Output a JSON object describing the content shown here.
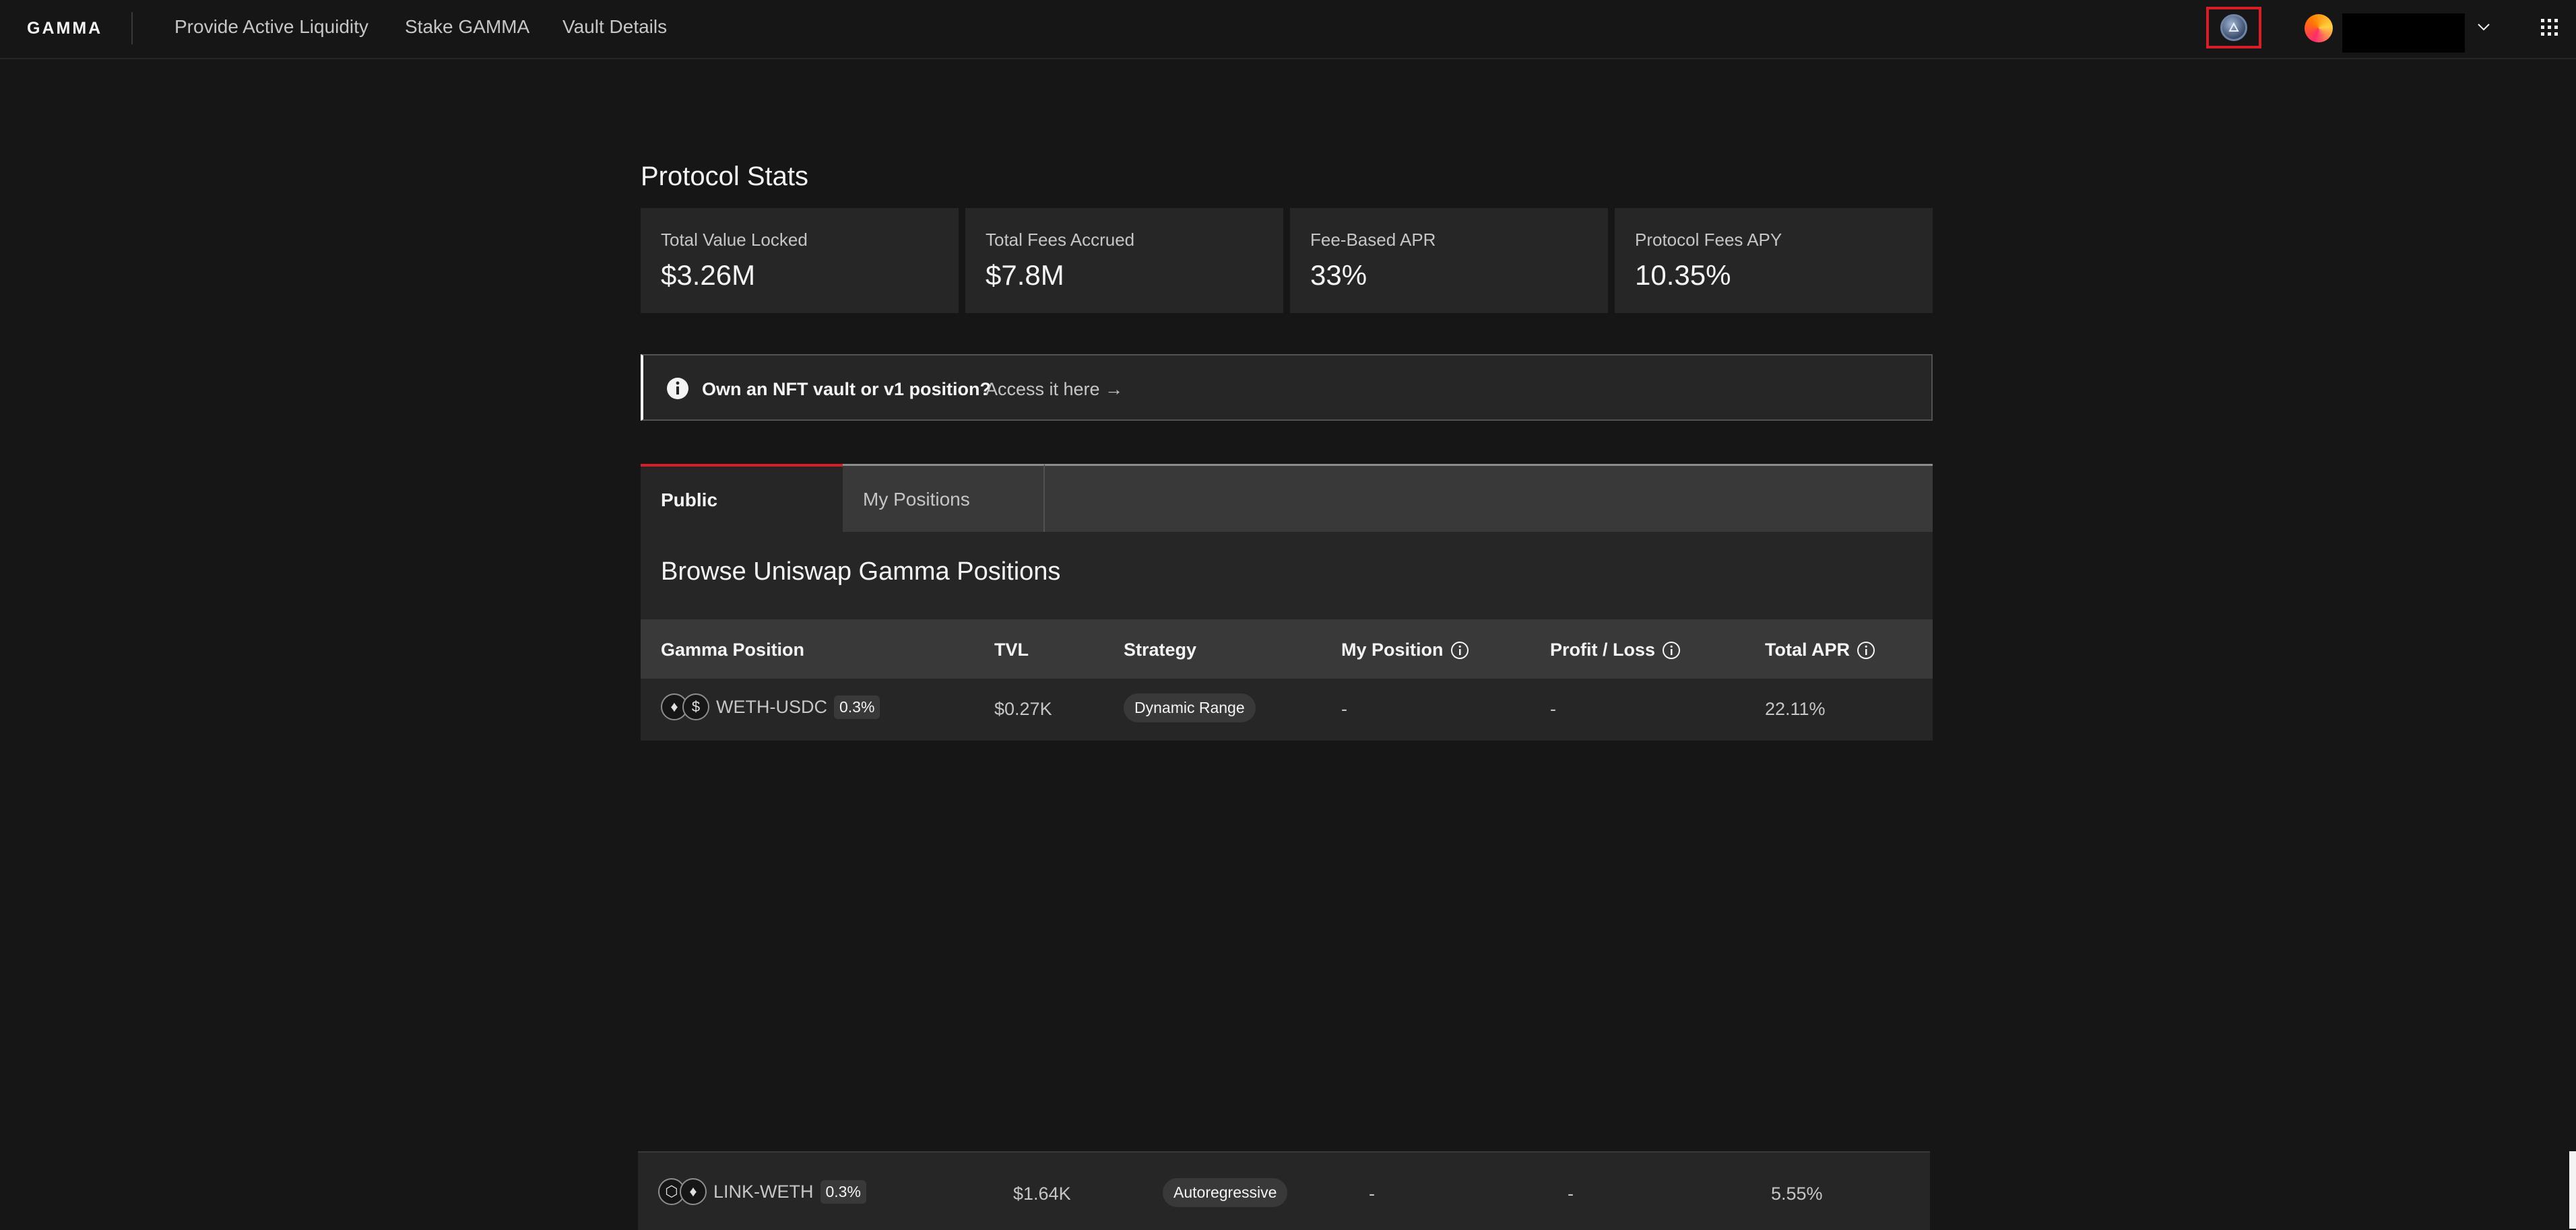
{
  "header": {
    "logo": "GAMMA",
    "nav": [
      "Provide Active Liquidity",
      "Stake GAMMA",
      "Vault Details"
    ]
  },
  "stats": {
    "title": "Protocol Stats",
    "cards": [
      {
        "label": "Total Value Locked",
        "value": "$3.26M"
      },
      {
        "label": "Total Fees Accrued",
        "value": "$7.8M"
      },
      {
        "label": "Fee-Based APR",
        "value": "33%"
      },
      {
        "label": "Protocol Fees APY",
        "value": "10.35%"
      }
    ]
  },
  "notice": {
    "title": "Own an NFT vault or v1 position?",
    "link": "Access it here →"
  },
  "tabs": [
    "Public",
    "My Positions"
  ],
  "browse": {
    "title": "Browse Uniswap Gamma Positions",
    "columns": [
      "Gamma Position",
      "TVL",
      "Strategy",
      "My Position",
      "Profit / Loss",
      "Total APR"
    ],
    "rows": [
      {
        "pair": "WETH-USDC",
        "fee": "0.3%",
        "tvl": "$0.27K",
        "strategy": "Dynamic Range",
        "my_position": "-",
        "pnl": "-",
        "apr": "22.11%"
      },
      {
        "pair": "LINK-WETH",
        "fee": "0.3%",
        "tvl": "$1.64K",
        "strategy": "Autoregressive",
        "my_position": "-",
        "pnl": "-",
        "apr": "5.55%"
      }
    ]
  },
  "colors": {
    "background": "#161616",
    "card": "#262626",
    "tab_accent": "#da1e28",
    "highlight_box": "#da1e28"
  },
  "icons": [
    "network-selector-icon",
    "wallet-avatar-icon",
    "chevron-down-icon",
    "app-switcher-icon",
    "info-icon",
    "eth-token-icon",
    "usdc-token-icon",
    "link-token-icon"
  ]
}
